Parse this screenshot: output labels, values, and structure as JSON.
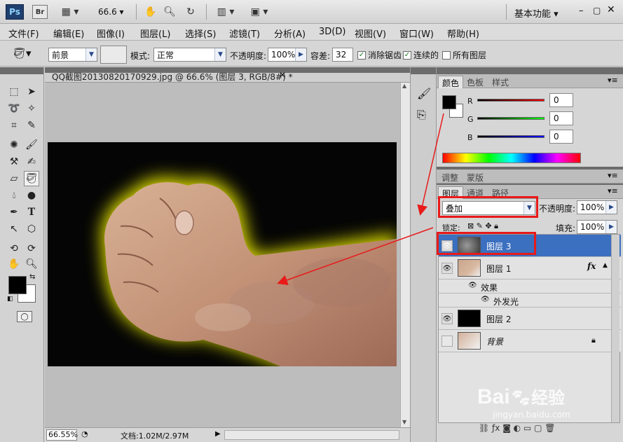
{
  "appbar": {
    "ps_badge": "Ps",
    "br_badge": "Br",
    "zoom": "66.6",
    "workspace": "基本功能"
  },
  "menu": [
    "文件(F)",
    "编辑(E)",
    "图像(I)",
    "图层(L)",
    "选择(S)",
    "滤镜(T)",
    "分析(A)",
    "3D(D)",
    "视图(V)",
    "窗口(W)",
    "帮助(H)"
  ],
  "options": {
    "fill_source": "前景",
    "mode_label": "模式:",
    "mode_value": "正常",
    "opacity_label": "不透明度:",
    "opacity_value": "100%",
    "tolerance_label": "容差:",
    "tolerance_value": "32",
    "anti_alias": "消除锯齿",
    "contiguous": "连续的",
    "all_layers": "所有图层"
  },
  "document": {
    "tab_title": "QQ截图20130820170929.jpg @ 66.6% (图层 3, RGB/8#) *",
    "zoom_status": "66.55%",
    "doc_info": "文档:1.02M/2.97M"
  },
  "color_panel": {
    "tabs": [
      "颜色",
      "色板",
      "样式"
    ],
    "r_label": "R",
    "g_label": "G",
    "b_label": "B",
    "r_value": "0",
    "g_value": "0",
    "b_value": "0"
  },
  "adjust_panel": {
    "tabs": [
      "调整",
      "蒙版"
    ]
  },
  "layers_panel": {
    "tabs": [
      "图层",
      "通道",
      "路径"
    ],
    "blend_mode": "叠加",
    "opacity_label": "不透明度:",
    "opacity_value": "100%",
    "lock_label": "锁定:",
    "fill_label": "填充:",
    "fill_value": "100%",
    "layers": [
      {
        "name": "图层 3",
        "selected": true,
        "visible": true
      },
      {
        "name": "图层 1",
        "selected": false,
        "visible": true,
        "fx": "fx"
      },
      {
        "name": "效果",
        "selected": false,
        "visible": true
      },
      {
        "name": "外发光",
        "selected": false,
        "visible": true
      },
      {
        "name": "图层 2",
        "selected": false,
        "visible": true
      },
      {
        "name": "背景",
        "selected": false,
        "visible": false
      }
    ]
  },
  "watermark": {
    "brand": "Bai",
    "brand2": "经验",
    "url": "jingyan.baidu.com"
  },
  "colors": {
    "selected_layer": "#3b6fbf",
    "annotation_red": "#e81a1a",
    "glow_yellow": "#e6e600"
  }
}
